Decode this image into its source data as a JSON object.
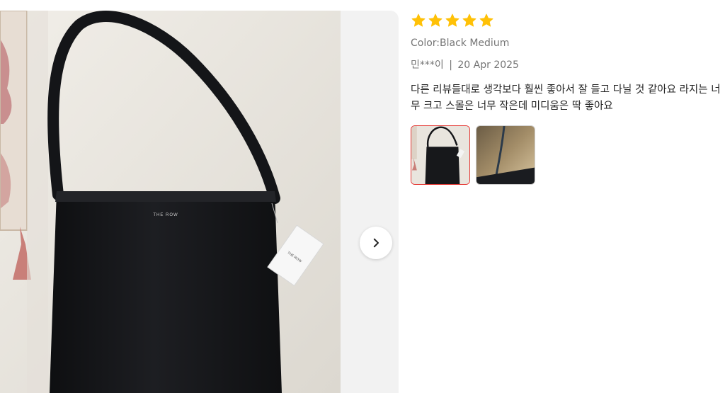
{
  "review": {
    "rating": 5,
    "stars": [
      "star",
      "star",
      "star",
      "star",
      "star"
    ],
    "star_color": "#FFC107",
    "variant": "Color:Black Medium",
    "reviewer": "민***이",
    "separator": "|",
    "date": "20 Apr 2025",
    "text": "다른 리뷰들대로 생각보다 훨씬 좋아서 잘 들고 다닐 것 같아요 라지는 너무 크고 스몰은 너무 작은데 미디움은 딱 좋아요"
  },
  "photo": {
    "brand_text": "THE ROW",
    "tag_text": "THE ROW",
    "bag_color": "#16171a",
    "wall_color": "#ece8e1"
  },
  "viewer": {
    "next_icon": "chevron-right-icon"
  },
  "thumbnails": [
    {
      "name": "thumbnail-bag-front",
      "active": true
    },
    {
      "name": "thumbnail-bag-inside",
      "active": false
    }
  ],
  "colors": {
    "active_thumb_border": "#e53935",
    "muted_text": "#757575",
    "body_text": "#222222"
  }
}
